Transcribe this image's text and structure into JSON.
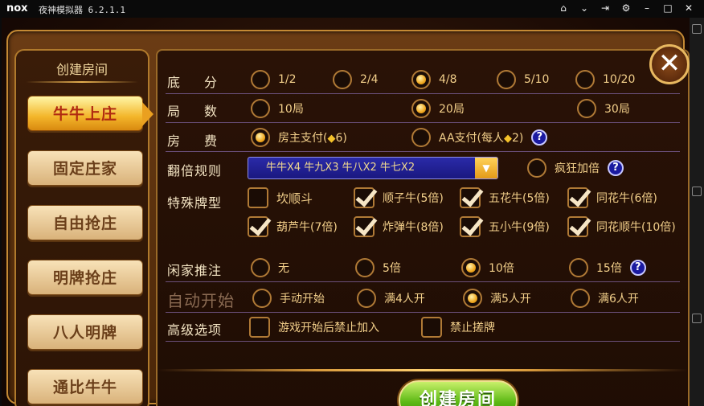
{
  "titlebar": {
    "logo": "nox",
    "title": "夜神模拟器 6.2.1.1",
    "icons": [
      "home-icon",
      "chevron-down-icon",
      "pin-icon",
      "gear-icon",
      "minimize-icon",
      "maximize-icon",
      "close-icon"
    ]
  },
  "left_menu": {
    "title": "创建房间",
    "items": [
      {
        "label": "牛牛上庄",
        "active": true
      },
      {
        "label": "固定庄家",
        "active": false
      },
      {
        "label": "自由抢庄",
        "active": false
      },
      {
        "label": "明牌抢庄",
        "active": false
      },
      {
        "label": "八人明牌",
        "active": false
      },
      {
        "label": "通比牛牛",
        "active": false
      }
    ]
  },
  "settings": {
    "base_score": {
      "label": "底分",
      "options": [
        {
          "label": "1/2",
          "selected": false
        },
        {
          "label": "2/4",
          "selected": false
        },
        {
          "label": "4/8",
          "selected": true
        },
        {
          "label": "5/10",
          "selected": false
        },
        {
          "label": "10/20",
          "selected": false
        }
      ]
    },
    "rounds": {
      "label": "局数",
      "options": [
        {
          "label": "10局",
          "selected": false
        },
        {
          "label": "20局",
          "selected": true
        },
        {
          "label": "30局",
          "selected": false
        }
      ]
    },
    "room_fee": {
      "label": "房费",
      "options": [
        {
          "prefix": "房主支付(",
          "suffix": "6)",
          "selected": true
        },
        {
          "prefix": "AA支付(每人",
          "suffix": "2)",
          "selected": false
        }
      ]
    },
    "double_rule": {
      "label": "翻倍规则",
      "value": "牛牛X4  牛九X3  牛八X2  牛七X2",
      "crazy_label": "疯狂加倍",
      "crazy_selected": false
    },
    "special": {
      "label": "特殊牌型",
      "options": [
        {
          "label": "坎顺斗",
          "checked": false
        },
        {
          "label": "顺子牛(5倍)",
          "checked": true
        },
        {
          "label": "五花牛(5倍)",
          "checked": true
        },
        {
          "label": "同花牛(6倍)",
          "checked": true
        },
        {
          "label": "葫芦牛(7倍)",
          "checked": true
        },
        {
          "label": "炸弹牛(8倍)",
          "checked": true
        },
        {
          "label": "五小牛(9倍)",
          "checked": true
        },
        {
          "label": "同花顺牛(10倍)",
          "checked": true
        }
      ]
    },
    "push_bet": {
      "label": "闲家推注",
      "options": [
        {
          "label": "无",
          "selected": false
        },
        {
          "label": "5倍",
          "selected": false
        },
        {
          "label": "10倍",
          "selected": true
        },
        {
          "label": "15倍",
          "selected": false
        }
      ]
    },
    "auto_start": {
      "label": "自动开始",
      "options": [
        {
          "label": "手动开始",
          "selected": false
        },
        {
          "label": "满4人开",
          "selected": false
        },
        {
          "label": "满5人开",
          "selected": true
        },
        {
          "label": "满6人开",
          "selected": false
        }
      ]
    },
    "advanced": {
      "label": "高级选项",
      "options": [
        {
          "label": "游戏开始后禁止加入",
          "checked": false
        },
        {
          "label": "禁止搓牌",
          "checked": false
        }
      ]
    }
  },
  "create_button": "创建房间",
  "help_glyph": "?",
  "close_glyph": "✕",
  "gem_glyph": "◆",
  "dropdown_arrow": "▼",
  "colors": {
    "accent_gold": "#f0a820",
    "panel_border": "#b07a2c",
    "create_green": "#5cb814",
    "help_blue": "#1a1aa0"
  }
}
